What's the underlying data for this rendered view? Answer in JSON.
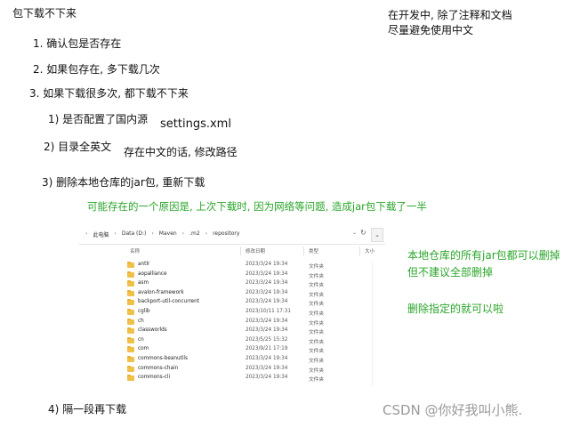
{
  "title": "包下载不下来",
  "notes": {
    "line1": "在开发中, 除了注释和文档",
    "line2": "尽量避免使用中文"
  },
  "steps": {
    "s1": "1. 确认包是否存在",
    "s2": "2. 如果包存在, 多下载几次",
    "s3": "3. 如果下载很多次, 都下载不下来"
  },
  "sub": {
    "a": "1) 是否配置了国内源",
    "a_note": "settings.xml",
    "b": "2) 目录全英文",
    "b_note": "存在中文的话, 修改路径",
    "c": "3) 删除本地仓库的jar包, 重新下载",
    "c_note": "可能存在的一个原因是, 上次下载时, 因为网络等问题, 造成jar包下载了一半",
    "d": "4) 隔一段再下载"
  },
  "right_notes": {
    "r1": "本地仓库的所有jar包都可以删掉",
    "r2": "但不建议全部删掉",
    "r3": "删除指定的就可以啦"
  },
  "watermark": "CSDN @你好我叫小熊.",
  "colors": {
    "green": "#2aa52a",
    "folder": "#f0c14a"
  },
  "explorer": {
    "breadcrumb": [
      "此电脑",
      "Data (D:)",
      "Maven",
      ".m2",
      "repository"
    ],
    "headers": {
      "name": "名称",
      "date": "修改日期",
      "type": "类型",
      "size": "大小"
    },
    "rows": [
      {
        "name": "antlr",
        "date": "2023/3/24 19:34",
        "type": "文件夹"
      },
      {
        "name": "aopalliance",
        "date": "2023/3/24 19:34",
        "type": "文件夹"
      },
      {
        "name": "asm",
        "date": "2023/3/24 19:34",
        "type": "文件夹"
      },
      {
        "name": "avalon-framework",
        "date": "2023/3/24 19:34",
        "type": "文件夹"
      },
      {
        "name": "backport-util-concurrent",
        "date": "2023/3/24 19:34",
        "type": "文件夹"
      },
      {
        "name": "cglib",
        "date": "2023/10/11 17:31",
        "type": "文件夹"
      },
      {
        "name": "ch",
        "date": "2023/3/24 19:34",
        "type": "文件夹"
      },
      {
        "name": "classworlds",
        "date": "2023/3/24 19:34",
        "type": "文件夹"
      },
      {
        "name": "cn",
        "date": "2023/5/25 15:32",
        "type": "文件夹"
      },
      {
        "name": "com",
        "date": "2023/9/21 17:19",
        "type": "文件夹"
      },
      {
        "name": "commons-beanutils",
        "date": "2023/3/24 19:34",
        "type": "文件夹"
      },
      {
        "name": "commons-chain",
        "date": "2023/3/24 19:34",
        "type": "文件夹"
      },
      {
        "name": "commons-cli",
        "date": "2023/3/24 19:34",
        "type": "文件夹"
      }
    ]
  }
}
